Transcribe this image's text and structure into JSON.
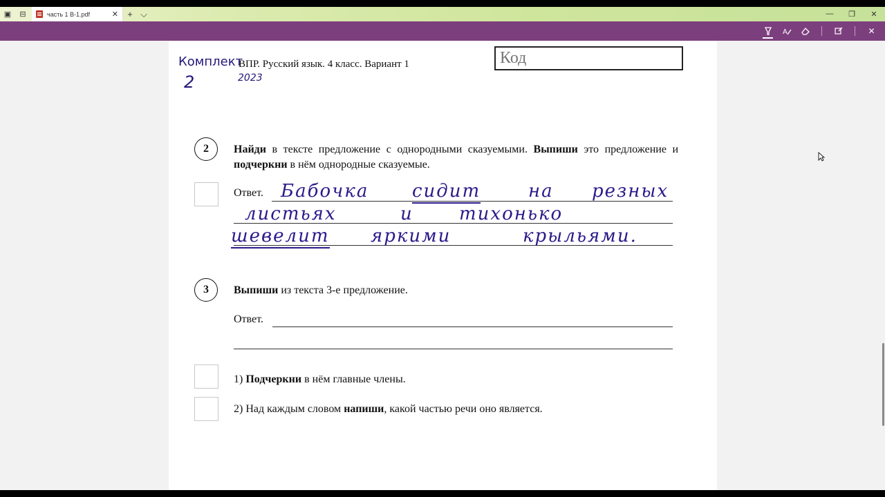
{
  "tabbar": {
    "tab_title": "часть 1 В-1.pdf",
    "close_glyph": "✕",
    "new_tab_glyph": "+",
    "chevron_glyph": "⌵",
    "minimize_glyph": "—",
    "restore_glyph": "❐",
    "window_close_glyph": "✕"
  },
  "toolbar": {
    "icons": [
      "highlight-icon",
      "text-highlight-icon",
      "eraser-icon",
      "touch-write-icon",
      "close-icon"
    ],
    "close_glyph": "✕"
  },
  "document": {
    "komplekt_label": "Комплект",
    "komplekt_number": "2",
    "year": "2023",
    "header": "ВПР. Русский язык. 4 класс. Вариант 1",
    "code_label": "Код",
    "q2": {
      "number": "2",
      "text_b1": "Найди",
      "text_1": " в тексте предложение с однородными сказуемыми. ",
      "text_b2": "Выпиши",
      "text_2": " это предложение и ",
      "text_b3": "подчеркни",
      "text_3": " в нём однородные сказуемые.",
      "answer_label": "Ответ.",
      "handwriting": {
        "w1": "Бабочка",
        "w2": "сидит",
        "w3": "на",
        "w4": "резных",
        "w5": "листьях",
        "w6": "и",
        "w7": "тихонько",
        "w8": "шевелит",
        "w9": "яркими",
        "w10": "крыльями."
      }
    },
    "q3": {
      "number": "3",
      "text_b1": "Выпиши",
      "text_1": " из текста 3-е предложение.",
      "answer_label": "Ответ.",
      "sub1_prefix": "1) ",
      "sub1_b": "Подчеркни",
      "sub1_text": " в нём главные члены.",
      "sub2_prefix": "2) Над каждым словом ",
      "sub2_b": "напиши",
      "sub2_text": ", какой частью речи оно является."
    }
  }
}
